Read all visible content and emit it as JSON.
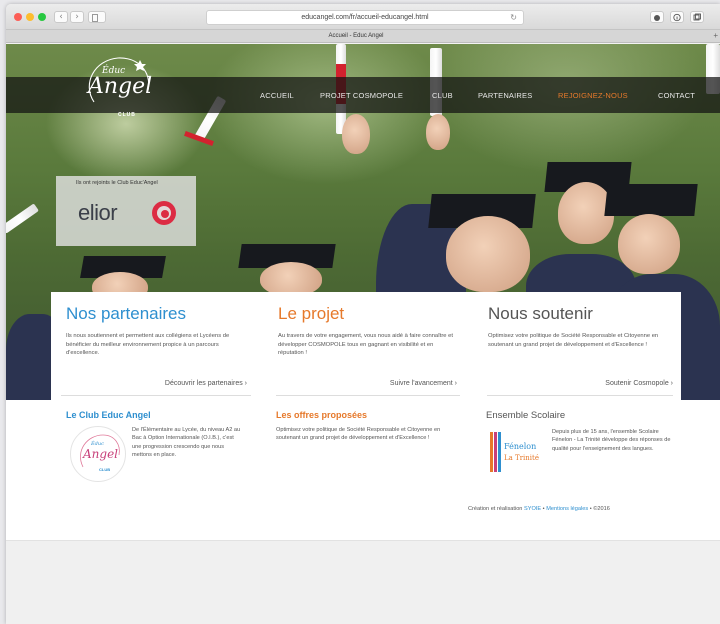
{
  "browser": {
    "url": "educangel.com/fr/accueil-educangel.html",
    "tab_title": "Accueil - Educ Angel",
    "back_glyph": "‹",
    "forward_glyph": "›",
    "reload_glyph": "↻",
    "plus_glyph": "+",
    "icons": [
      "back-icon",
      "forward-icon",
      "sidebar-icon",
      "reload-icon",
      "share-icon",
      "info-icon",
      "tabs-icon",
      "new-tab-icon"
    ]
  },
  "logo": {
    "educ": "Éduc",
    "angel": "Angel",
    "club": "CLUB"
  },
  "nav": {
    "items": [
      {
        "label": "ACCUEIL"
      },
      {
        "label": "PROJET COSMOPOLE"
      },
      {
        "label": "CLUB"
      },
      {
        "label": "PARTENAIRES"
      },
      {
        "label": "REJOIGNEZ-NOUS"
      },
      {
        "label": "CONTACT"
      }
    ],
    "active_color": "#e6792b"
  },
  "joined": {
    "label": "Ils ont rejoints le Club Educ'Angel",
    "partner": "elior"
  },
  "columns": [
    {
      "title": "Nos partenaires",
      "text": "Ils nous soutiennent et permettent aux collégiens et Lycéens de bénéficier du meilleur environnement propice à un parcours d'excellence.",
      "link": "Découvrir les partenaires  ›",
      "color": "#2e8fcf"
    },
    {
      "title": "Le projet",
      "text": "Au travers de votre engagement, vous nous aidé à faire connaître et développer COSMOPOLE tous en gagnant en visibilité et en réputation !",
      "link": "Suivre l'avancement  ›",
      "color": "#e6792b"
    },
    {
      "title": "Nous soutenir",
      "text": "Optimisez votre politique de Société Responsable et Citoyenne en soutenant un grand projet de développement et d'Excellence !",
      "link": "Soutenir Cosmopole  ›",
      "color": "#555555"
    }
  ],
  "lower": {
    "club": {
      "title": "Le Club Educ Angel",
      "text": "De l'Élémentaire au Lycée, du niveau A2 au Bac à Option Internationale (O.I.B.), c'est une progression crescendo que nous mettons en place.",
      "logo_educ": "Éduc",
      "logo_angel": "Angel",
      "logo_club": "CLUB"
    },
    "offres": {
      "title": "Les offres proposées",
      "text": "Optimisez votre politique de Société Responsable et Citoyenne en soutenant un grand projet de développement et d'Excellence !"
    },
    "ensemble": {
      "title": "Ensemble Scolaire",
      "text": "Depuis plus de 15 ans, l'ensemble Scolaire Fénelon - La Trinité développe des réponses de qualité pour l'enseignement des langues.",
      "logo_top": "Fénelon",
      "logo_bottom": "La Trinité"
    }
  },
  "footer": {
    "prefix": "Création et réalisation",
    "agency": "SYOIE",
    "sep": "•",
    "legal": "Mentions légales",
    "suffix": "• ©2016"
  }
}
